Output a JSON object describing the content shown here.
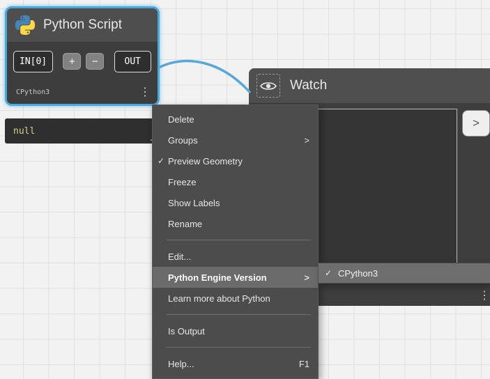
{
  "python_node": {
    "title": "Python Script",
    "input_port": "IN[0]",
    "add_button": "+",
    "remove_button": "−",
    "output_port": "OUT",
    "engine": "CPython3"
  },
  "preview": {
    "value": "null"
  },
  "watch_node": {
    "title": "Watch",
    "expand_button": ">"
  },
  "context_menu": {
    "items": [
      {
        "label": "Delete"
      },
      {
        "label": "Groups",
        "has_submenu": true
      },
      {
        "label": "Preview Geometry",
        "checked": true
      },
      {
        "label": "Freeze"
      },
      {
        "label": "Show Labels"
      },
      {
        "label": "Rename"
      },
      {
        "label": "Edit..."
      },
      {
        "label": "Python Engine Version",
        "has_submenu": true,
        "highlighted": true
      },
      {
        "label": "Learn more about Python"
      },
      {
        "label": "Is Output"
      },
      {
        "label": "Help...",
        "shortcut": "F1"
      }
    ]
  },
  "submenu": {
    "items": [
      {
        "label": "CPython3",
        "checked": true,
        "highlighted": true
      }
    ]
  },
  "icons": {
    "kebab_glyph": "⋮",
    "check_glyph": "✓",
    "arrow_glyph": ">"
  },
  "colors": {
    "selection_blue": "#48a9dd",
    "wire_blue": "#57a7da",
    "python_blue": "#4584b6",
    "python_yellow": "#ffd845",
    "null_text": "#d8cf8f"
  }
}
